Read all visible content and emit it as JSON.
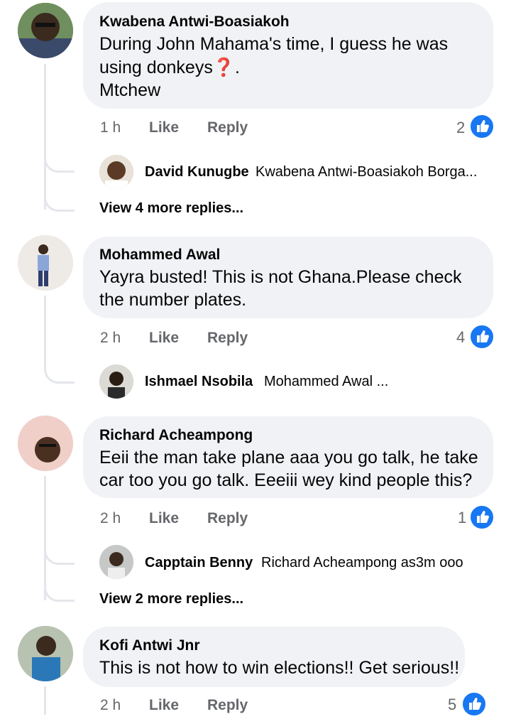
{
  "comments": [
    {
      "author": "Kwabena Antwi-Boasiakoh",
      "line1": "During John Mahama's time, I guess he was",
      "line2": "using donkeys❓.",
      "line3": "Mtchew",
      "time": "1 h",
      "like": "Like",
      "reply": "Reply",
      "reactions": "2",
      "reply_preview": {
        "author": "David Kunugbe",
        "text": "Kwabena Antwi-Boasiakoh Borga..."
      },
      "more_replies": "View 4 more replies..."
    },
    {
      "author": "Mohammed Awal",
      "line1": "Yayra busted! This is not Ghana.Please check",
      "line2": "the number plates.",
      "time": "2 h",
      "like": "Like",
      "reply": "Reply",
      "reactions": "4",
      "reply_preview": {
        "author": "Ishmael Nsobila",
        "text": "Mohammed Awal ..."
      }
    },
    {
      "author": "Richard Acheampong",
      "line1": "Eeii the man take plane aaa you go talk, he take",
      "line2": "car too you go talk. Eeeiii wey kind people this?",
      "time": "2 h",
      "like": "Like",
      "reply": "Reply",
      "reactions": "1",
      "reply_preview": {
        "author": "Capptain Benny",
        "text": "Richard Acheampong as3m ooo"
      },
      "more_replies": "View 2 more replies..."
    },
    {
      "author": "Kofi Antwi Jnr",
      "line1": "This is not how to win elections!! Get serious!!",
      "time": "2 h",
      "like": "Like",
      "reply": "Reply",
      "reactions": "5"
    }
  ],
  "colors": {
    "bubble": "#f0f2f5",
    "meta": "#65676b",
    "like_blue": "#1877f2",
    "thread_line": "#e4e6eb"
  },
  "icons": {
    "reaction": "thumbs-up-icon"
  }
}
